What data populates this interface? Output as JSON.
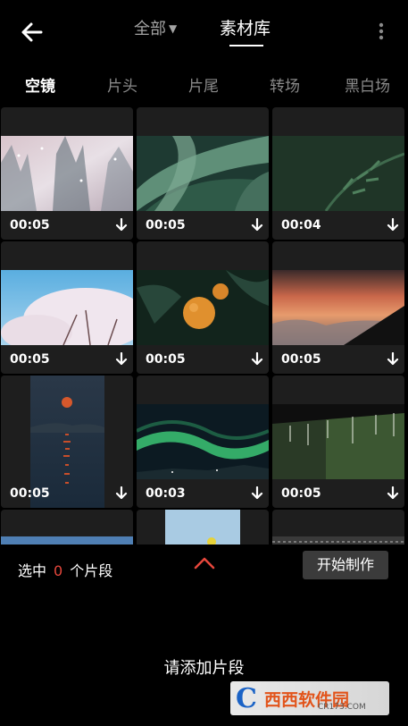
{
  "header": {
    "tab_all": "全部",
    "tab_library": "素材库"
  },
  "categories": [
    "空镜",
    "片头",
    "片尾",
    "转场",
    "黑白场"
  ],
  "clips": [
    {
      "duration": "00:05",
      "scene": "snowy-forest"
    },
    {
      "duration": "00:05",
      "scene": "green-leaves"
    },
    {
      "duration": "00:04",
      "scene": "dark-green-foliage"
    },
    {
      "duration": "00:05",
      "scene": "cherry-blossoms"
    },
    {
      "duration": "00:05",
      "scene": "oranges-on-tree"
    },
    {
      "duration": "00:05",
      "scene": "sunset-clouds"
    },
    {
      "duration": "00:05",
      "scene": "moon-over-water"
    },
    {
      "duration": "00:03",
      "scene": "aurora"
    },
    {
      "duration": "00:05",
      "scene": "rain-on-roof"
    }
  ],
  "bottom": {
    "selected_prefix": "选中",
    "selected_count": "0",
    "selected_suffix": "个片段",
    "start_button": "开始制作",
    "hint": "请添加片段"
  },
  "watermark": {
    "brand_letter": "C",
    "brand_text": "西西软件园",
    "url": "CR173.COM"
  }
}
